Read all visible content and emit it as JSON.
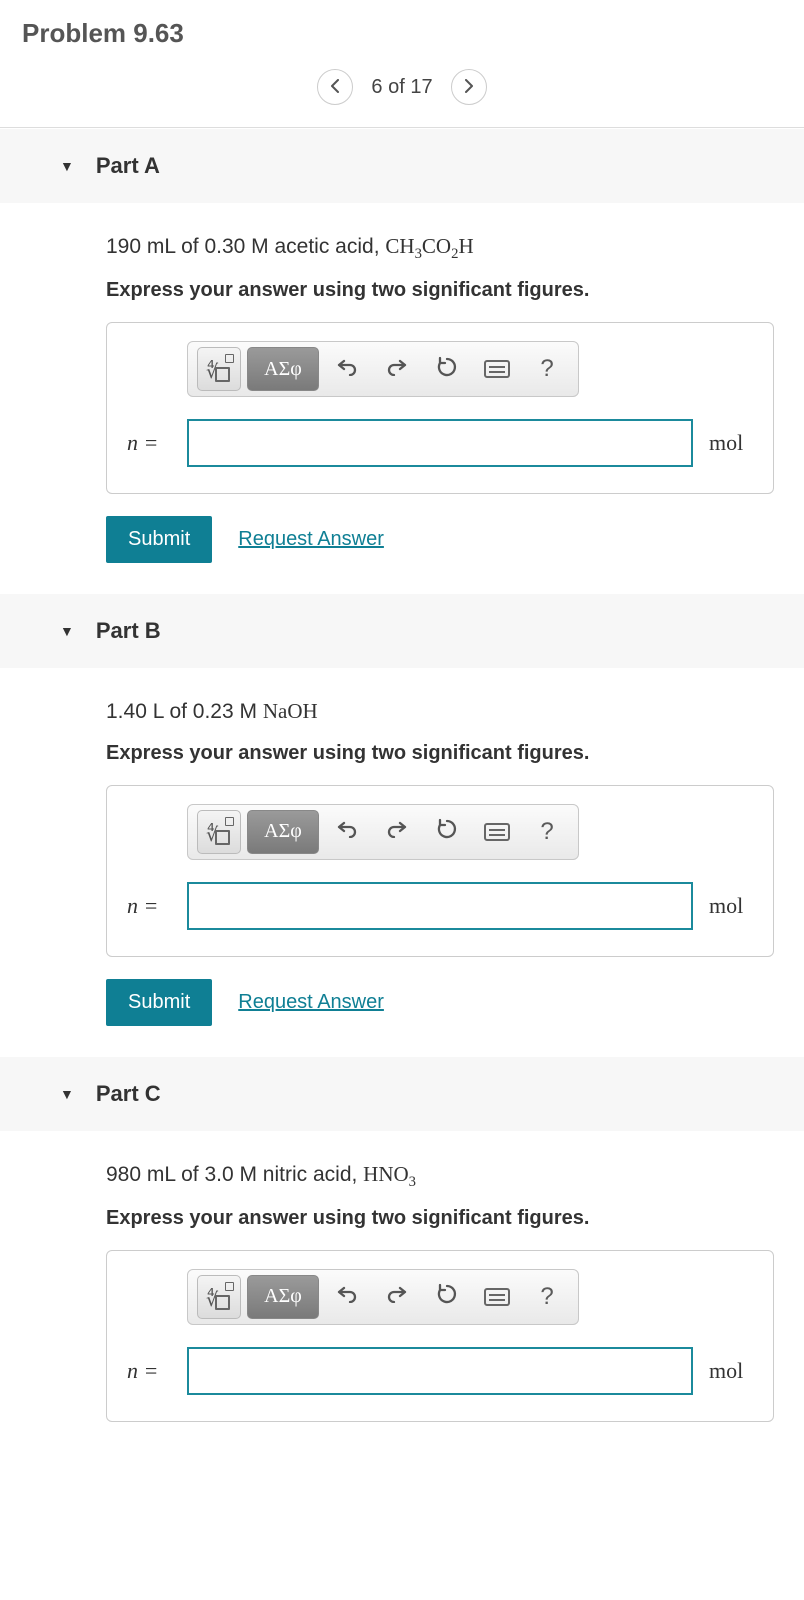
{
  "header": {
    "title": "Problem 9.63"
  },
  "pager": {
    "label": "6 of 17"
  },
  "toolbar": {
    "greek_label": "ΑΣφ",
    "help_label": "?"
  },
  "common": {
    "submit_label": "Submit",
    "request_label": "Request Answer",
    "instruction": "Express your answer using two significant figures.",
    "var_label": "n =",
    "unit_label": "mol"
  },
  "parts": [
    {
      "title": "Part A",
      "q_prefix": "190 mL of 0.30 M acetic acid, ",
      "q_formula_html": "CH<sub>3</sub>CO<sub>2</sub>H"
    },
    {
      "title": "Part B",
      "q_prefix": "1.40 L of 0.23 M ",
      "q_formula_html": "NaOH"
    },
    {
      "title": "Part C",
      "q_prefix": "980 mL of 3.0 M nitric acid, ",
      "q_formula_html": "HNO<sub>3</sub>"
    }
  ]
}
